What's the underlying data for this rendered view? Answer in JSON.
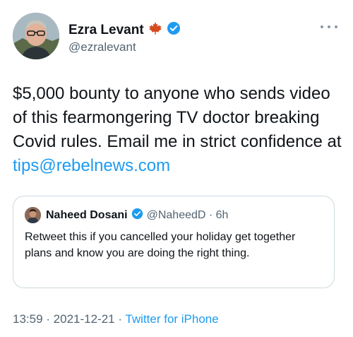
{
  "author": {
    "name": "Ezra Levant",
    "handle": "@ezralevant"
  },
  "tweet": {
    "text": "$5,000 bounty to anyone who sends video of this fearmongering TV doctor breaking Covid rules. Email me in strict confidence at ",
    "link": "tips@rebelnews.com"
  },
  "quoted": {
    "name": "Naheed Dosani",
    "handle_time": "@NaheedD · 6h",
    "text": "Retweet this if you cancelled your holiday get together plans and know you are doing the right thing."
  },
  "meta": {
    "time": "13:59",
    "sep1": " · ",
    "date": "2021-12-21",
    "sep2": " · ",
    "source": "Twitter for iPhone"
  },
  "icons": {
    "author_flag": "maple-leaf-icon",
    "verified": "verified-badge-icon",
    "more": "more-options-icon"
  },
  "colors": {
    "link": "#1d9bf0",
    "verified": "#1d9bf0",
    "maple": "#d64a1f",
    "muted": "#536471"
  }
}
